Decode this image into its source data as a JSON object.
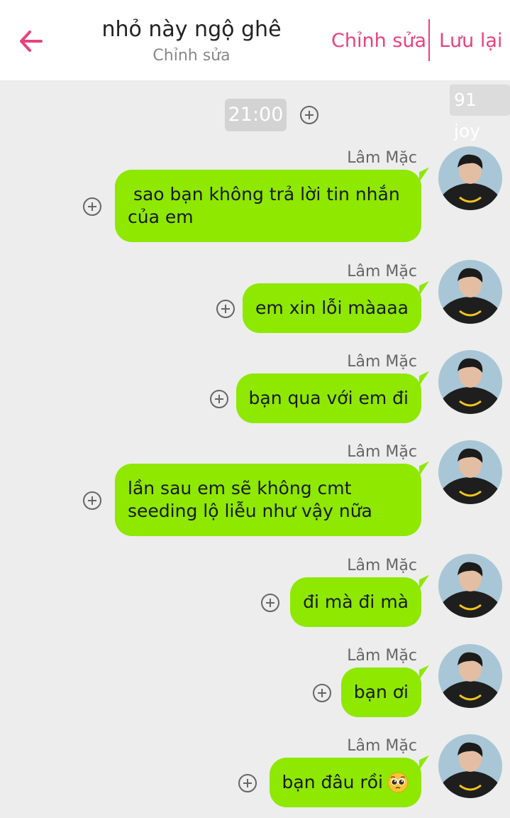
{
  "header": {
    "title": "nhỏ này ngộ ghê",
    "subtitle": "Chỉnh sửa",
    "edit_label": "Chỉnh sửa",
    "save_label": "Lưu lại",
    "accent_color": "#e8427d"
  },
  "badge": "91 joy",
  "timestamp": "21:00",
  "bubble_color": "#8ee800",
  "messages": [
    {
      "sender": "Lâm Mặc",
      "text_lines": [
        " sao bạn không trả lời tin nhắn",
        "của em"
      ]
    },
    {
      "sender": "Lâm Mặc",
      "text_lines": [
        "em xin lỗi màaaa"
      ]
    },
    {
      "sender": "Lâm Mặc",
      "text_lines": [
        "bạn qua với em đi"
      ]
    },
    {
      "sender": "Lâm Mặc",
      "text_lines": [
        "lần sau em sẽ không cmt",
        "seeding lộ liễu như vậy nữa"
      ]
    },
    {
      "sender": "Lâm Mặc",
      "text_lines": [
        "đi mà đi mà"
      ]
    },
    {
      "sender": "Lâm Mặc",
      "text_lines": [
        "bạn ơi"
      ]
    },
    {
      "sender": "Lâm Mặc",
      "text_lines": [
        "bạn đâu rồi"
      ],
      "emoji": "pleading-face-icon"
    }
  ]
}
